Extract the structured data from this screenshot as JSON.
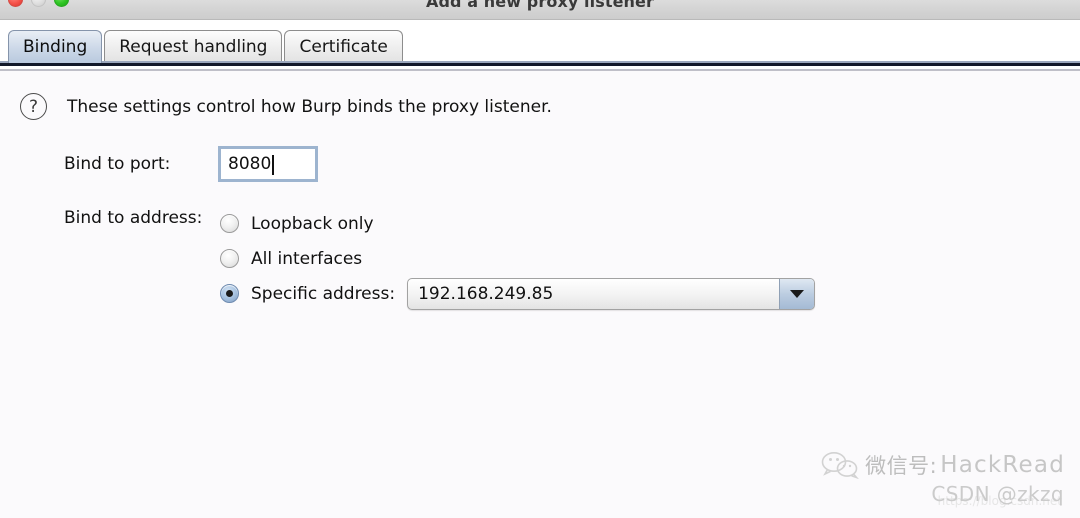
{
  "window": {
    "title": "Add a new proxy listener",
    "controls": {
      "close": "close-button",
      "minimize": "minimize-button",
      "zoom": "zoom-button"
    }
  },
  "tabs": [
    {
      "label": "Binding",
      "selected": true
    },
    {
      "label": "Request handling",
      "selected": false
    },
    {
      "label": "Certificate",
      "selected": false
    }
  ],
  "binding_panel": {
    "help_icon": "question-mark-icon",
    "help_text": "These settings control how Burp binds the proxy listener.",
    "port": {
      "label": "Bind to port:",
      "value": "8080",
      "placeholder": ""
    },
    "address": {
      "label": "Bind to address:",
      "options": [
        {
          "label": "Loopback only",
          "selected": false
        },
        {
          "label": "All interfaces",
          "selected": false
        },
        {
          "label": "Specific address:",
          "selected": true
        }
      ],
      "selected_address": "192.168.249.85",
      "dropdown_icon": "chevron-down-icon"
    }
  },
  "watermark": {
    "logo": "wechat-icon",
    "wechat_label": "微信号:",
    "brand": "HackRead",
    "credit": "CSDN @zkzq",
    "faint_url": "https://blog.csdn.net"
  },
  "colors": {
    "titlebar": "#d2d2d2",
    "content_bg": "#fbfafc",
    "tab_selected": "#ccd8e8",
    "separator_dark": "#12182a",
    "focus_border": "#9db4cf",
    "close": "#f5524a",
    "minimize": "#dfdfdf",
    "zoom": "#2fc524"
  }
}
